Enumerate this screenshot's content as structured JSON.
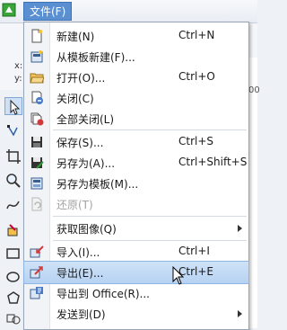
{
  "menubar": {
    "file_menu": "文件(F)"
  },
  "propbar": {
    "x_label": "x:",
    "y_label": "y:"
  },
  "stub": "00",
  "colors": {
    "menu_highlight": "#5a8fd2",
    "item_hover": "#b7d2f2"
  },
  "menu": {
    "items": [
      {
        "icon": "new-document-icon",
        "label": "新建(N)",
        "shortcut": "Ctrl+N"
      },
      {
        "icon": "new-from-template-icon",
        "label": "从模板新建(F)...",
        "shortcut": ""
      },
      {
        "icon": "open-folder-icon",
        "label": "打开(O)...",
        "shortcut": "Ctrl+O"
      },
      {
        "icon": "close-document-icon",
        "label": "关闭(C)",
        "shortcut": ""
      },
      {
        "icon": "close-all-icon",
        "label": "全部关闭(L)",
        "shortcut": ""
      },
      {
        "icon": "save-icon",
        "label": "保存(S)...",
        "shortcut": "Ctrl+S"
      },
      {
        "icon": "save-as-icon",
        "label": "另存为(A)...",
        "shortcut": "Ctrl+Shift+S"
      },
      {
        "icon": "save-as-template-icon",
        "label": "另存为模板(M)...",
        "shortcut": ""
      },
      {
        "icon": "revert-icon",
        "label": "还原(T)",
        "shortcut": "",
        "disabled": true
      },
      {
        "icon": "",
        "label": "获取图像(Q)",
        "shortcut": "",
        "submenu": true
      },
      {
        "icon": "import-icon",
        "label": "导入(I)...",
        "shortcut": "Ctrl+I"
      },
      {
        "icon": "export-icon",
        "label": "导出(E)...",
        "shortcut": "Ctrl+E",
        "hover": true
      },
      {
        "icon": "export-office-icon",
        "label": "导出到 Office(R)...",
        "shortcut": ""
      },
      {
        "icon": "",
        "label": "发送到(D)",
        "shortcut": "",
        "submenu": true
      }
    ]
  }
}
